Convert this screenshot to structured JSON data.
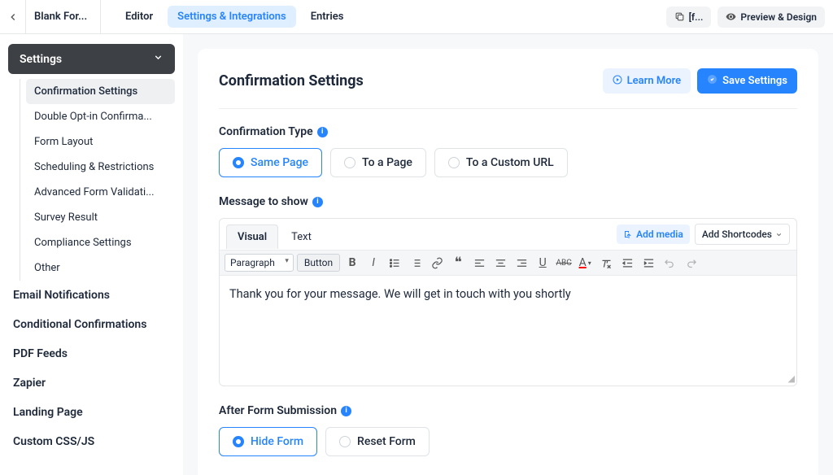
{
  "header": {
    "form_title": "Blank For...",
    "tabs": {
      "editor": "Editor",
      "settings": "Settings & Integrations",
      "entries": "Entries"
    },
    "short_btn": "[f...",
    "preview_btn": "Preview & Design"
  },
  "sidebar": {
    "settings_label": "Settings",
    "tree": [
      "Confirmation Settings",
      "Double Opt-in Confirma...",
      "Form Layout",
      "Scheduling & Restrictions",
      "Advanced Form Validati...",
      "Survey Result",
      "Compliance Settings",
      "Other"
    ],
    "items": [
      "Email Notifications",
      "Conditional Confirmations",
      "PDF Feeds",
      "Zapier",
      "Landing Page",
      "Custom CSS/JS"
    ]
  },
  "panel": {
    "title": "Confirmation Settings",
    "learn_more": "Learn More",
    "save": "Save Settings",
    "confirmation_type_label": "Confirmation Type",
    "confirmation_options": {
      "same_page": "Same Page",
      "to_page": "To a Page",
      "custom_url": "To a Custom URL"
    },
    "message_label": "Message to show",
    "editor": {
      "tab_visual": "Visual",
      "tab_text": "Text",
      "add_media": "Add media",
      "add_shortcodes": "Add Shortcodes",
      "paragraph_sel": "Paragraph",
      "button_btn": "Button",
      "body": "Thank you for your message. We will get in touch with you shortly"
    },
    "after_submit_label": "After Form Submission",
    "after_options": {
      "hide": "Hide Form",
      "reset": "Reset Form"
    }
  }
}
